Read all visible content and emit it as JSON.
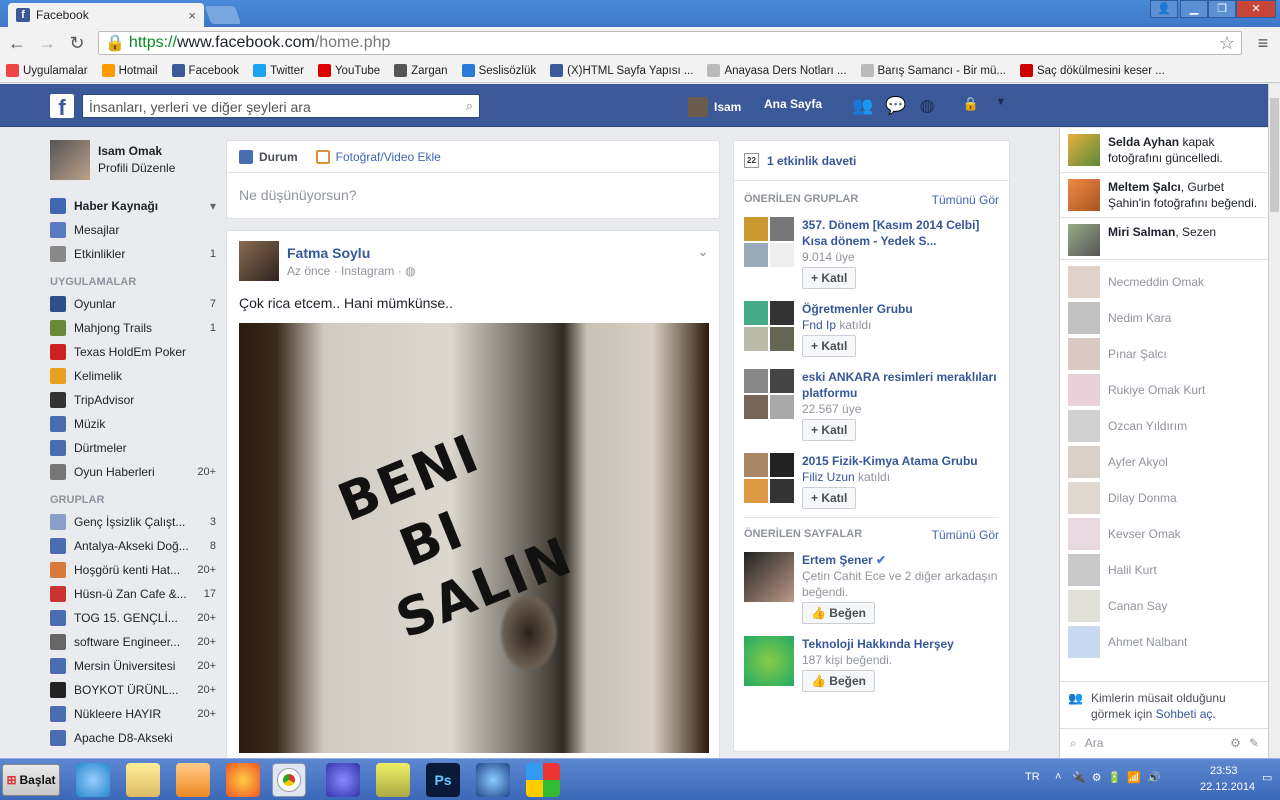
{
  "browser": {
    "tab_title": "Facebook",
    "tab_close": "×",
    "url_scheme": "https://",
    "url_host": "www.facebook.com",
    "url_path": "/home.php",
    "bookmarks": [
      {
        "label": "Uygulamalar",
        "color": "#e44"
      },
      {
        "label": "Hotmail",
        "color": "#f90"
      },
      {
        "label": "Facebook",
        "color": "#3b5998"
      },
      {
        "label": "Twitter",
        "color": "#1da1f2"
      },
      {
        "label": "YouTube",
        "color": "#d00"
      },
      {
        "label": "Zargan",
        "color": "#555"
      },
      {
        "label": "Seslisözlük",
        "color": "#2a7ad8"
      },
      {
        "label": "(X)HTML Sayfa Yapısı ...",
        "color": "#3a5a9a"
      },
      {
        "label": "Anayasa Ders Notları ...",
        "color": "#bbb"
      },
      {
        "label": "Barış Samancı - Bir mü...",
        "color": "#bbb"
      },
      {
        "label": "Saç dökülmesini keser ...",
        "color": "#c00"
      }
    ]
  },
  "fb_header": {
    "logo": "f",
    "search_placeholder": "İnsanları, yerleri ve diğer şeyleri ara",
    "user_name": "Isam",
    "home_label": "Ana Sayfa"
  },
  "left": {
    "profile_name": "Isam Omak",
    "profile_edit": "Profili Düzenle",
    "main_items": [
      {
        "label": "Haber Kaynağı",
        "count": "",
        "color": "#4267b2"
      },
      {
        "label": "Mesajlar",
        "count": "",
        "color": "#5b7bc0"
      },
      {
        "label": "Etkinlikler",
        "count": "1",
        "color": "#888"
      }
    ],
    "apps_title": "UYGULAMALAR",
    "apps": [
      {
        "label": "Oyunlar",
        "count": "7",
        "color": "#2d4f8c"
      },
      {
        "label": "Mahjong Trails",
        "count": "1",
        "color": "#6a8a3a"
      },
      {
        "label": "Texas HoldEm Poker",
        "count": "",
        "color": "#c22"
      },
      {
        "label": "Kelimelik",
        "count": "",
        "color": "#e8a020"
      },
      {
        "label": "TripAdvisor",
        "count": "",
        "color": "#333"
      },
      {
        "label": "Müzik",
        "count": "",
        "color": "#4a6db0"
      },
      {
        "label": "Dürtmeler",
        "count": "",
        "color": "#4a6db0"
      },
      {
        "label": "Oyun Haberleri",
        "count": "20+",
        "color": "#777"
      }
    ],
    "groups_title": "GRUPLAR",
    "groups": [
      {
        "label": "Genç İşsizlik Çalışt...",
        "count": "3",
        "color": "#8aa0c8"
      },
      {
        "label": "Antalya-Akseki Doğ...",
        "count": "8",
        "color": "#4a6db0"
      },
      {
        "label": "Hoşgörü kenti Hat...",
        "count": "20+",
        "color": "#d87a3a"
      },
      {
        "label": "Hüsn-ü Zan Cafe &...",
        "count": "17",
        "color": "#c33"
      },
      {
        "label": "TOG 15. GENÇLİ...",
        "count": "20+",
        "color": "#4a6db0"
      },
      {
        "label": "software Engineer...",
        "count": "20+",
        "color": "#666"
      },
      {
        "label": "Mersin Üniversitesi",
        "count": "20+",
        "color": "#4a6db0"
      },
      {
        "label": "BOYKOT ÜRÜNL...",
        "count": "20+",
        "color": "#222"
      },
      {
        "label": "Nükleere HAYIR",
        "count": "20+",
        "color": "#4a6db0"
      },
      {
        "label": "Apache D8-Akseki",
        "count": "",
        "color": "#4a6db0"
      }
    ]
  },
  "composer": {
    "tab_status": "Durum",
    "tab_photo": "Fotoğraf/Video Ekle",
    "placeholder": "Ne düşünüyorsun?"
  },
  "post": {
    "author": "Fatma Soylu",
    "meta": "Az önce · Instagram ·",
    "text": "Çok rica etcem.. Hani mümkünse..",
    "image_text": "BENI BI SALIN"
  },
  "right": {
    "event_invites": "1 etkinlik daveti",
    "groups_header": "ÖNERİLEN GRUPLAR",
    "see_all": "Tümünü Gör",
    "join_label": "Katıl",
    "suggested_groups": [
      {
        "name": "357. Dönem [Kasım 2014 Celbi] Kısa dönem - Yedek S...",
        "sub": "9.014 üye",
        "sub_link": ""
      },
      {
        "name": "Öğretmenler Grubu",
        "sub": " katıldı",
        "sub_link": "Fnd Ip"
      },
      {
        "name": "eski ANKARA resimleri meraklıları platformu",
        "sub": "22.567 üye",
        "sub_link": ""
      },
      {
        "name": "2015 Fizik-Kimya Atama Grubu",
        "sub": " katıldı",
        "sub_link": "Filiz Uzun"
      }
    ],
    "pages_header": "ÖNERİLEN SAYFALAR",
    "like_label": "Beğen",
    "pages": [
      {
        "name": "Ertem Şener",
        "sub": "Çetin Cahit Ece ve 2 diğer arkadaşın beğendi."
      },
      {
        "name": "Teknoloji Hakkında Herşey",
        "sub": "187 kişi beğendi."
      }
    ]
  },
  "chat": {
    "ticker": [
      {
        "name": "Selda Ayhan",
        "text": " kapak fotoğrafını güncelledi."
      },
      {
        "name": "Meltem Şalcı",
        "text": ", Gurbet Şahin'in fotoğrafını beğendi."
      },
      {
        "name": "Miri Salman",
        "text": ", Sezen"
      }
    ],
    "contacts": [
      "Necmeddin Omak",
      "Nedim Kara",
      "Pınar Şalcı",
      "Rukiye Omak Kurt",
      "Ozcan Yıldırım",
      "Ayfer Akyol",
      "Dilay Donma",
      "Kevser Omak",
      "Halil Kurt",
      "Canan Say",
      "Ahmet Nalbant"
    ],
    "footer_text": "Kimlerin müsait olduğunu görmek için",
    "footer_link": "Sohbeti aç.",
    "search_placeholder": "Ara"
  },
  "taskbar": {
    "start_label": "Başlat",
    "lang": "TR",
    "time": "23:53",
    "date": "22.12.2014"
  }
}
